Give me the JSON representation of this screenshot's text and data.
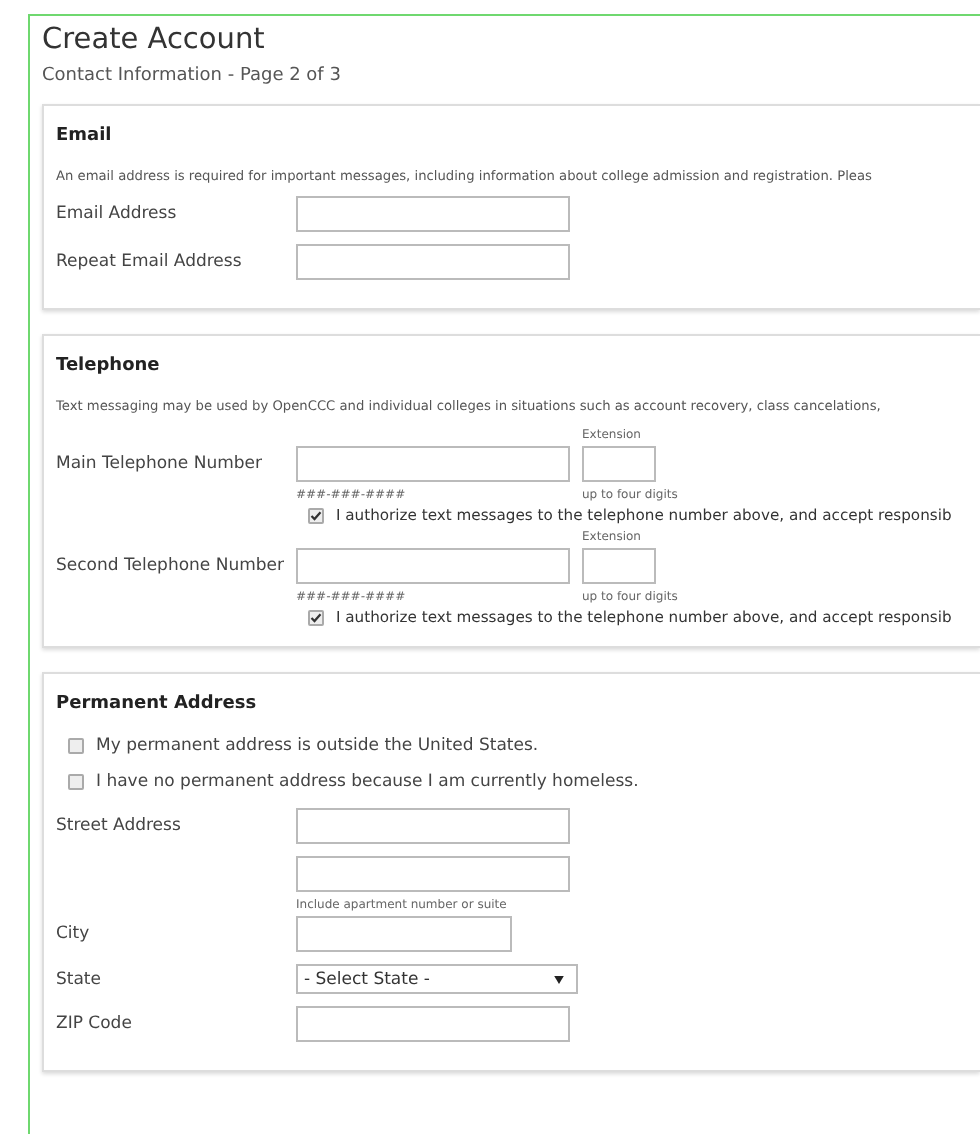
{
  "title": "Create Account",
  "subtitle": "Contact Information - Page 2 of 3",
  "email": {
    "heading": "Email",
    "description": "An email address is required for important messages, including information about college admission and registration. Pleas",
    "fields": [
      {
        "label": "Email Address"
      },
      {
        "label": "Repeat Email Address"
      }
    ]
  },
  "telephone": {
    "heading": "Telephone",
    "description": "Text messaging may be used by OpenCCC and individual colleges in situations such as account recovery, class cancelations,",
    "phones": [
      {
        "label": "Main Telephone Number",
        "extension_label": "Extension",
        "format_hint": "###-###-####",
        "extension_hint": "up to four digits",
        "consent": {
          "label": "I authorize text messages to the telephone number above, and accept responsib",
          "checked": true
        }
      },
      {
        "label": "Second Telephone Number",
        "extension_label": "Extension",
        "format_hint": "###-###-####",
        "extension_hint": "up to four digits",
        "consent": {
          "label": "I authorize text messages to the telephone number above, and accept responsib",
          "checked": true
        }
      }
    ]
  },
  "address": {
    "heading": "Permanent Address",
    "options": [
      {
        "label": "My permanent address is outside the United States.",
        "checked": false
      },
      {
        "label": "I have no permanent address because I am currently homeless.",
        "checked": false
      }
    ],
    "street": {
      "label": "Street Address",
      "hint": "Include apartment number or suite"
    },
    "city": {
      "label": "City"
    },
    "state": {
      "label": "State",
      "value": "- Select State -"
    },
    "zip": {
      "label": "ZIP Code"
    }
  }
}
